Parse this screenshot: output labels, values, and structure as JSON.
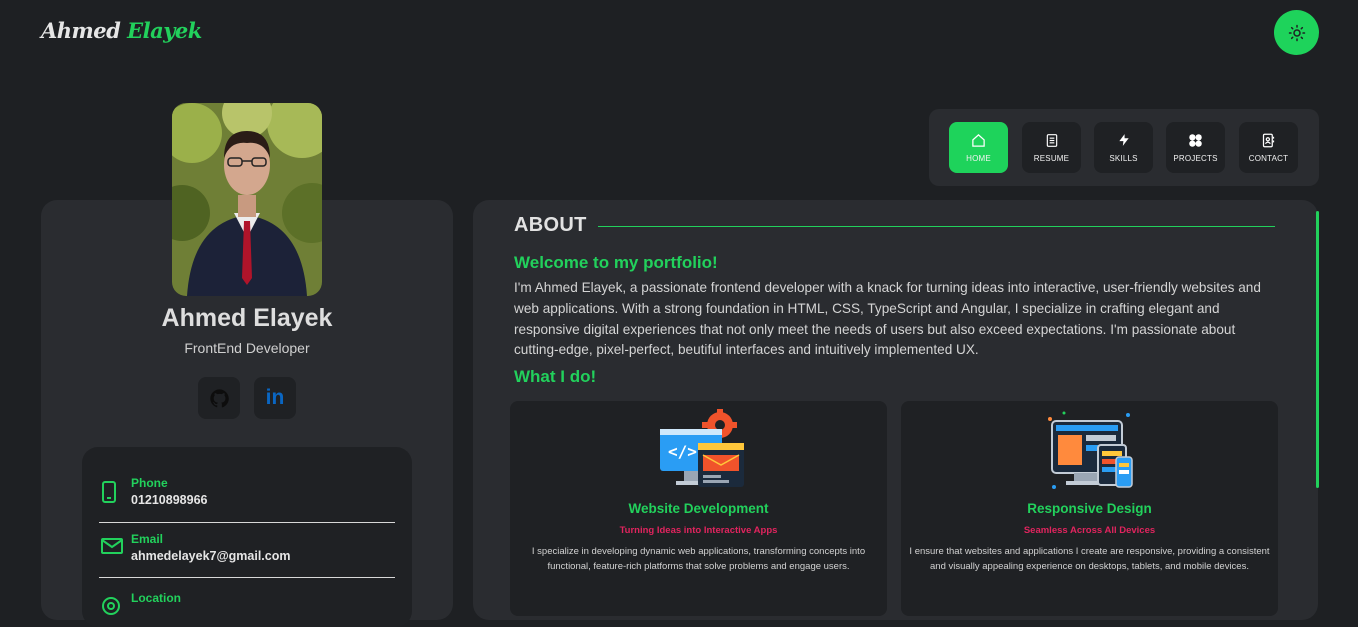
{
  "header": {
    "logo_first": "Ahmed",
    "logo_last": "Elayek",
    "theme_icon": "sun-icon"
  },
  "nav": {
    "items": [
      {
        "label": "HOME",
        "icon": "home-icon",
        "active": true
      },
      {
        "label": "RESUME",
        "icon": "resume-icon",
        "active": false
      },
      {
        "label": "SKILLS",
        "icon": "bolt-icon",
        "active": false
      },
      {
        "label": "PROJECTS",
        "icon": "grid-icon",
        "active": false
      },
      {
        "label": "CONTACT",
        "icon": "contact-book-icon",
        "active": false
      }
    ]
  },
  "profile": {
    "name": "Ahmed Elayek",
    "role": "FrontEnd Developer",
    "social": [
      {
        "icon": "github-icon"
      },
      {
        "icon": "linkedin-icon",
        "text": "in"
      }
    ]
  },
  "contact": {
    "phone_label": "Phone",
    "phone_value": "01210898966",
    "email_label": "Email",
    "email_value": "ahmedelayek7@gmail.com",
    "location_label": "Location"
  },
  "about": {
    "title": "ABOUT",
    "welcome": "Welcome to my portfolio!",
    "bio": "I'm Ahmed Elayek, a passionate frontend developer with a knack for turning ideas into interactive, user-friendly websites and web applications. With a strong foundation in HTML, CSS, TypeScript and Angular, I specialize in crafting elegant and responsive digital experiences that not only meet the needs of users but also exceed expectations. I'm passionate about cutting-edge, pixel-perfect, beutiful interfaces and intuitively implemented UX.",
    "whatido": "What I do!"
  },
  "services": [
    {
      "title": "Website Development",
      "subtitle": "Turning Ideas into Interactive Apps",
      "desc": "I specialize in developing dynamic web applications, transforming concepts into functional, feature-rich platforms that solve problems and engage users.",
      "icon": "web-development-icon"
    },
    {
      "title": "Responsive Design",
      "subtitle": "Seamless Across All Devices",
      "desc": "I ensure that websites and applications I create are responsive, providing a consistent and visually appealing experience on desktops, tablets, and mobile devices.",
      "icon": "responsive-design-icon"
    }
  ],
  "colors": {
    "accent": "#22d15c",
    "background": "#1e2023",
    "card": "#2a2c30",
    "subtitle": "#e0245e"
  }
}
